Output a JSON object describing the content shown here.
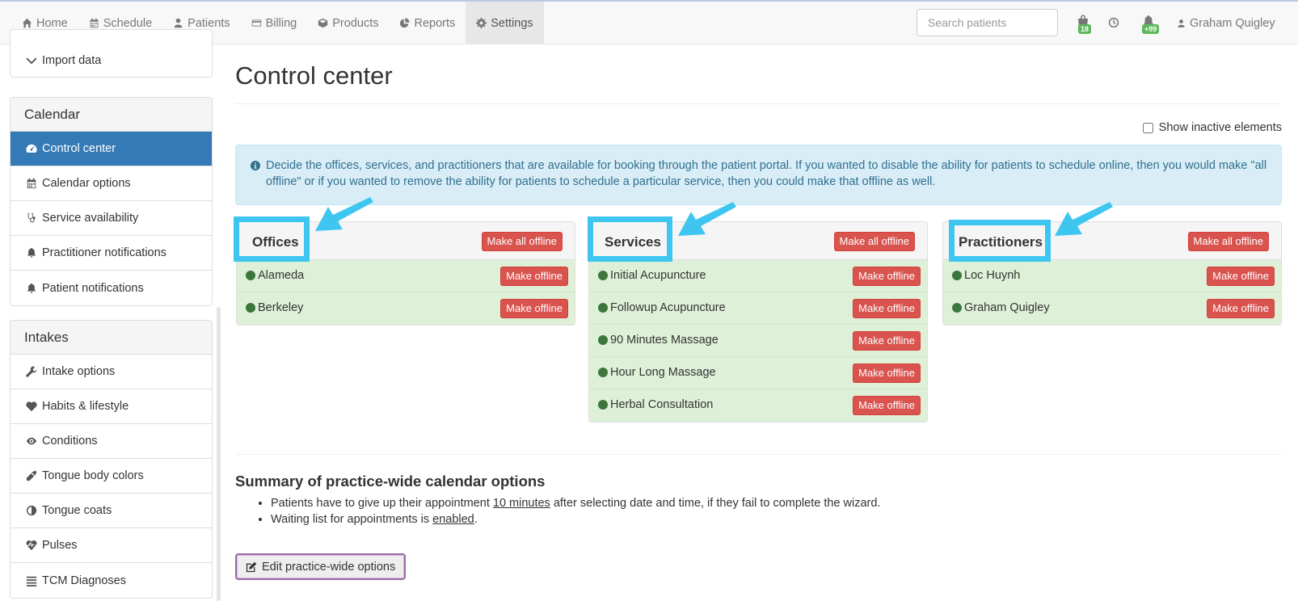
{
  "nav": {
    "items": [
      {
        "label": "Home",
        "icon": "home-icon"
      },
      {
        "label": "Schedule",
        "icon": "calendar-icon"
      },
      {
        "label": "Patients",
        "icon": "user-icon"
      },
      {
        "label": "Billing",
        "icon": "credit-card-icon"
      },
      {
        "label": "Products",
        "icon": "box-icon"
      },
      {
        "label": "Reports",
        "icon": "pie-chart-icon"
      },
      {
        "label": "Settings",
        "icon": "gear-icon",
        "active": true
      }
    ],
    "search_placeholder": "Search patients",
    "inbox_badge": "18",
    "notifications_badge": "+99",
    "user_name": "Graham Quigley"
  },
  "sidebar": {
    "top_partial_item": "Import data",
    "calendar": {
      "heading": "Calendar",
      "items": [
        {
          "label": "Control center",
          "icon": "dashboard-icon",
          "active": true
        },
        {
          "label": "Calendar options",
          "icon": "calendar-icon"
        },
        {
          "label": "Service availability",
          "icon": "stethoscope-icon"
        },
        {
          "label": "Practitioner notifications",
          "icon": "bell-icon"
        },
        {
          "label": "Patient notifications",
          "icon": "bell-icon"
        }
      ]
    },
    "intakes": {
      "heading": "Intakes",
      "items": [
        {
          "label": "Intake options",
          "icon": "wrench-icon"
        },
        {
          "label": "Habits & lifestyle",
          "icon": "heart-icon"
        },
        {
          "label": "Conditions",
          "icon": "eye-icon"
        },
        {
          "label": "Tongue body colors",
          "icon": "eyedropper-icon"
        },
        {
          "label": "Tongue coats",
          "icon": "adjust-icon"
        },
        {
          "label": "Pulses",
          "icon": "heartbeat-icon"
        },
        {
          "label": "TCM Diagnoses",
          "icon": "list-icon"
        }
      ]
    }
  },
  "main": {
    "title": "Control center",
    "show_inactive_label": "Show inactive elements",
    "info_text": "Decide the offices, services, and practitioners that are available for booking through the patient portal. If you wanted to disable the ability for patients to schedule online, then you would make \"all offline\" or if you wanted to remove the ability for patients to schedule a particular service, then you could make that offline as well.",
    "make_all_offline_label": "Make all offline",
    "make_offline_label": "Make offline",
    "offices": {
      "title": "Offices",
      "items": [
        "Alameda",
        "Berkeley"
      ]
    },
    "services": {
      "title": "Services",
      "items": [
        "Initial Acupuncture",
        "Followup Acupuncture",
        "90 Minutes Massage",
        "Hour Long Massage",
        "Herbal Consultation"
      ]
    },
    "practitioners": {
      "title": "Practitioners",
      "items": [
        "Loc Huynh",
        "Graham Quigley"
      ]
    },
    "summary": {
      "title": "Summary of practice-wide calendar options",
      "line1_before": "Patients have to give up their appointment ",
      "line1_link": "10 minutes",
      "line1_after": " after selecting date and time, if they fail to complete the wizard.",
      "line2_before": "Waiting list for appointments is ",
      "line2_link": "enabled",
      "line2_after": "."
    },
    "edit_button_label": "Edit practice-wide options"
  },
  "colors": {
    "primary": "#337ab7",
    "danger": "#d9534f",
    "success_bg": "#dff0d8",
    "online_dot": "#3c763d",
    "info_bg": "#d9edf7",
    "highlight": "#3ec6f0"
  }
}
